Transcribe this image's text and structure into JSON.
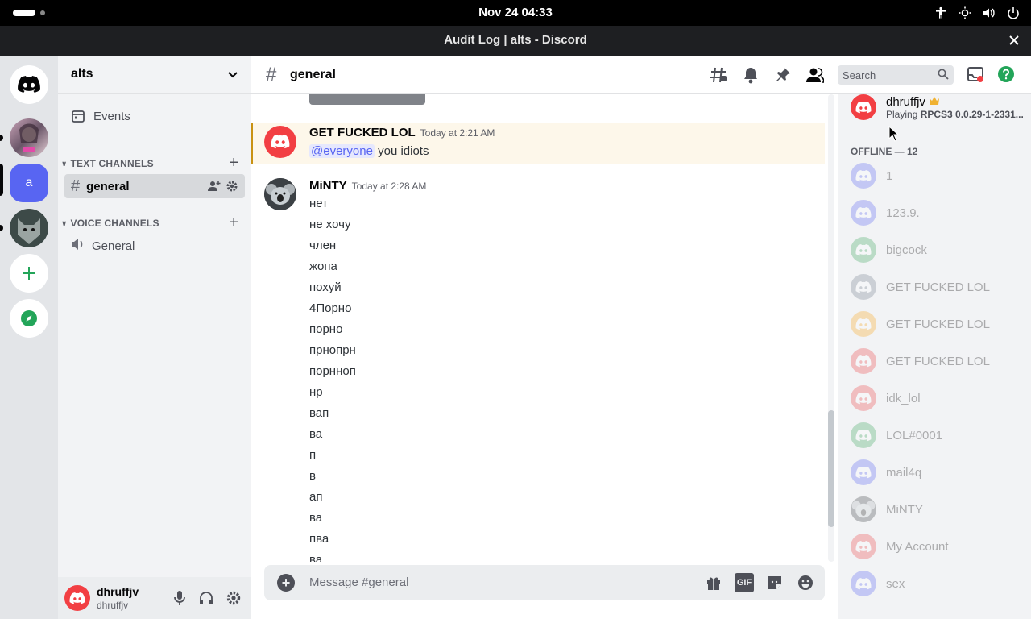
{
  "system": {
    "clock": "Nov 24  04:33"
  },
  "window": {
    "title": "Audit Log | alts - Discord"
  },
  "guild": {
    "name": "alts",
    "events_label": "Events",
    "text_category": "TEXT CHANNELS",
    "voice_category": "VOICE CHANNELS",
    "text_channels": [
      "general"
    ],
    "voice_channels": [
      "General"
    ],
    "server_letter": "a"
  },
  "user": {
    "name": "dhruffjv",
    "tag": "dhruffjv"
  },
  "chat": {
    "channel": "general",
    "search_placeholder": "Search",
    "composer_placeholder": "Message #general",
    "gif_label": "GIF",
    "messages": [
      {
        "author": "GET FUCKED LOL",
        "time": "Today at 2:21 AM",
        "mention": "@everyone",
        "text": "you idiots"
      },
      {
        "author": "MiNTY",
        "time": "Today at 2:28 AM",
        "lines": [
          "нет",
          "не хочу",
          "член",
          "жопа",
          "похуй",
          "4Порно",
          "порно",
          "прнопрн",
          "порнноп",
          "нр",
          "вап",
          "ва",
          "п",
          "в",
          "ап",
          "ва",
          "пва",
          "ва"
        ]
      }
    ]
  },
  "members": {
    "online": {
      "name": "dhruffjv",
      "activity_prefix": "Playing",
      "activity": "RPCS3 0.0.29-1-2331..."
    },
    "offline_header": "OFFLINE — 12",
    "offline": [
      {
        "name": "1",
        "color": "#5865f2"
      },
      {
        "name": "123.9.",
        "color": "#5865f2"
      },
      {
        "name": "bigcock",
        "color": "#3ba55c"
      },
      {
        "name": "GET FUCKED LOL",
        "color": "#747f8d"
      },
      {
        "name": "GET FUCKED LOL",
        "color": "#faa61a"
      },
      {
        "name": "GET FUCKED LOL",
        "color": "#ed4245"
      },
      {
        "name": "idk_lol",
        "color": "#ed4245"
      },
      {
        "name": "LOL#0001",
        "color": "#3ba55c"
      },
      {
        "name": "mail4q",
        "color": "#5865f2"
      },
      {
        "name": "MiNTY",
        "color": "#777777"
      },
      {
        "name": "My Account",
        "color": "#ed4245"
      },
      {
        "name": "sex",
        "color": "#5865f2"
      }
    ]
  },
  "colors": {
    "accent": "#5865f2",
    "danger": "#f23f43",
    "mention_bg": "#e6e8fd",
    "highlight_bg": "#fdf7ea"
  }
}
